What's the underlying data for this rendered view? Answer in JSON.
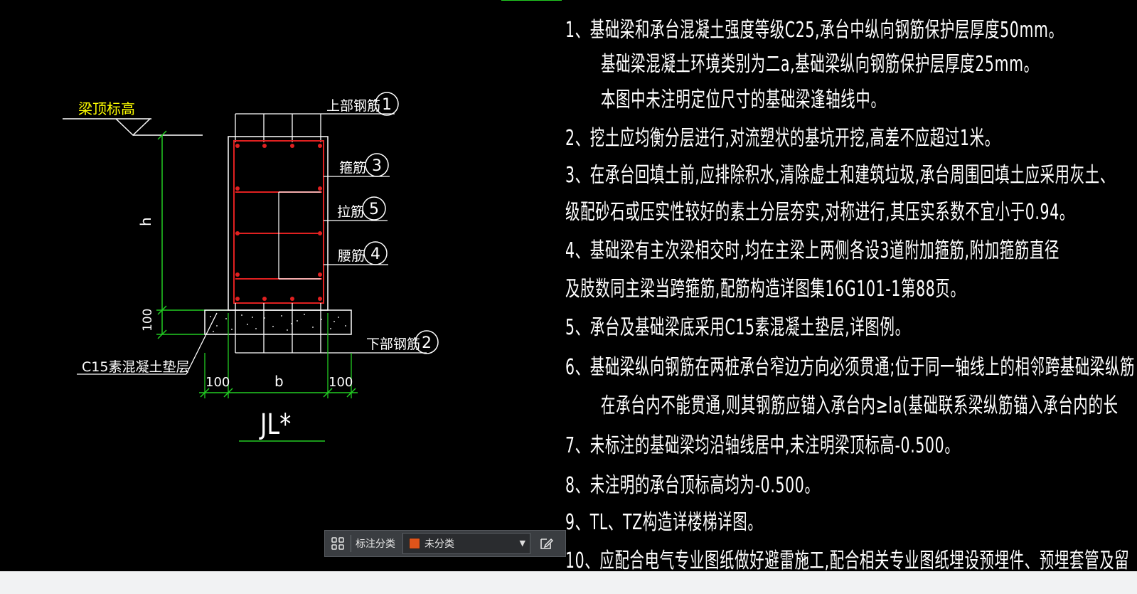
{
  "drawing": {
    "elevation_label": "梁顶标高",
    "top_rebar_label": "上部钢筋",
    "top_rebar_num": "1",
    "stirrup_label": "箍筋",
    "stirrup_num": "3",
    "tie_label": "拉筋",
    "tie_num": "5",
    "waist_label": "腰筋",
    "waist_num": "4",
    "bottom_rebar_label": "下部钢筋",
    "bottom_rebar_num": "2",
    "height_label": "h",
    "cushion_dim": "100",
    "cushion_label": "C15素混凝土垫层",
    "left_offset_dim": "100",
    "width_label": "b",
    "right_offset_dim": "100",
    "section_title": "JL*"
  },
  "notes": [
    "1、基础梁和承台混凝土强度等级C25,承台中纵向钢筋保护层厚度50mm。",
    "基础梁混凝土环境类别为二a,基础梁纵向钢筋保护层厚度25mm。",
    "本图中未注明定位尺寸的基础梁逢轴线中。",
    "2、挖土应均衡分层进行,对流塑状的基坑开挖,高差不应超过1米。",
    "3、在承台回填土前,应排除积水,清除虚土和建筑垃圾,承台周围回填土应采用灰土、",
    "级配砂石或压实性较好的素土分层夯实,对称进行,其压实系数不宜小于0.94。",
    "4、基础梁有主次梁相交时,均在主梁上两侧各设3道附加箍筋,附加箍筋直径",
    "及肢数同主梁当跨箍筋,配筋构造详图集16G101-1第88页。",
    "5、承台及基础梁底采用C15素混凝土垫层,详图例。",
    "6、基础梁纵向钢筋在两桩承台窄边方向必须贯通;位于同一轴线上的相邻跨基础梁纵筋",
    "在承台内不能贯通,则其钢筋应锚入承台内≥la(基础联系梁纵筋锚入承台内的长",
    "7、未标注的基础梁均沿轴线居中,未注明梁顶标高-0.500。",
    "8、未注明的承台顶标高均为-0.500。",
    "9、TL、TZ构造详楼梯详图。",
    "10、应配合电气专业图纸做好避雷施工,配合相关专业图纸埋设预埋件、预埋套管及留"
  ],
  "toolbar": {
    "layout_icon": "grid-icon",
    "category_label": "标注分类",
    "category_value": "未分类",
    "category_color": "#e0541a",
    "edit_icon": "edit-icon"
  },
  "colors": {
    "background": "#000000",
    "line": "#ffffff",
    "rebar": "#e02020",
    "dimension": "#22cc22",
    "label": "#ffff00",
    "note_text": "#ffffff"
  }
}
